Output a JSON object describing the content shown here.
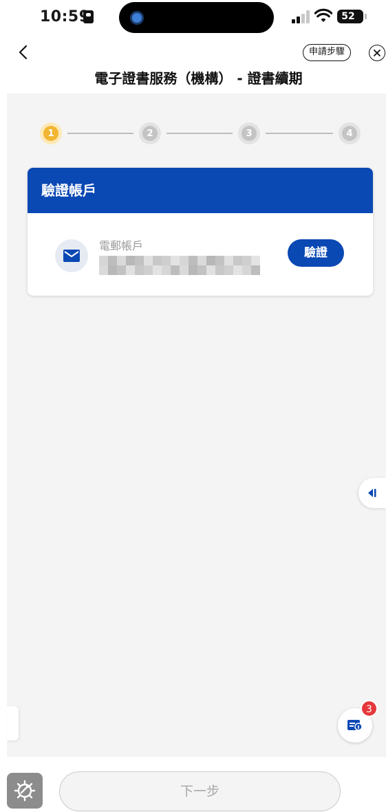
{
  "status_bar": {
    "time": "10:59",
    "battery": "52",
    "battery_level": 0.52,
    "signal_bars_active": 2,
    "icons": [
      "id-card-icon",
      "screen-record-icon",
      "signal-icon",
      "wifi-icon",
      "battery-icon"
    ]
  },
  "header": {
    "back_icon": "chevron-left-icon",
    "steps_label": "申請步驟",
    "close_icon": "close-circle-icon",
    "title": "電子證書服務（機構） - 證書續期"
  },
  "stepper": {
    "steps": [
      "1",
      "2",
      "3",
      "4"
    ],
    "current_step": 1,
    "colors": {
      "active": "#f2b632",
      "inactive": "#c4c4c4"
    }
  },
  "card": {
    "title": "驗證帳戶",
    "field_label": "電郵帳戶",
    "field_icon": "mail-icon",
    "verify_label": "驗證"
  },
  "floating": {
    "side_tab_icon": "collapse-left-icon",
    "fab_icon": "form-help-icon",
    "fab_badge": "3"
  },
  "footer": {
    "gear_icon": "settings-gear-icon",
    "next_label": "下一步"
  },
  "colors": {
    "brand_blue": "#0a48b4",
    "badge_red": "#e5383b",
    "background_gray": "#f4f4f4"
  }
}
